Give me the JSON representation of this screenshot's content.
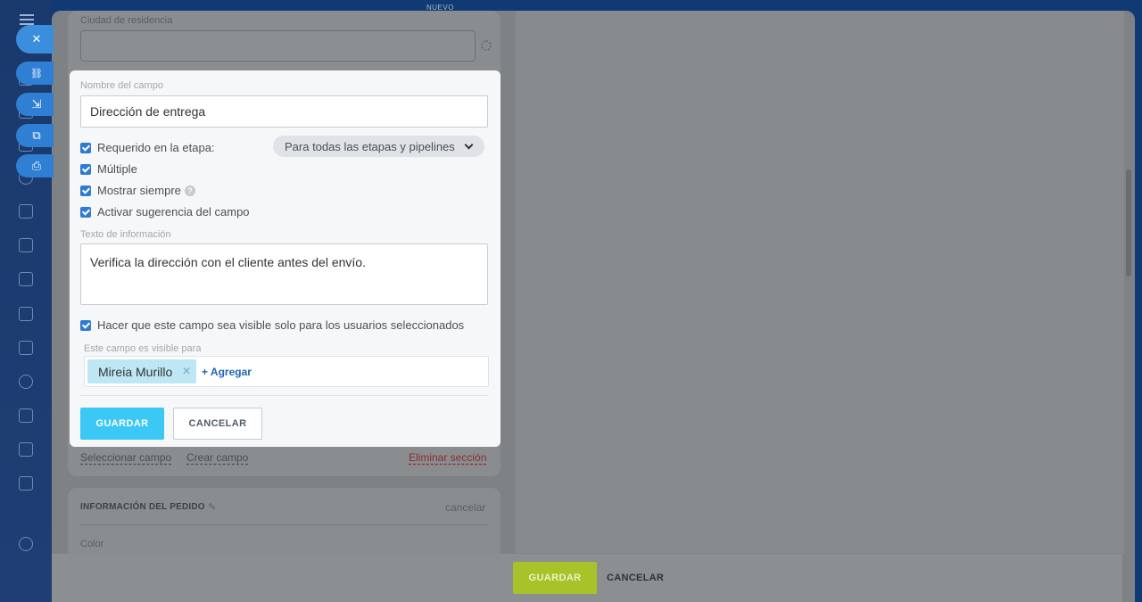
{
  "app": {
    "top_label": "NUEVO"
  },
  "rail_icons": [
    "menu-icon",
    "chat-icon",
    "feed-icon",
    "target-icon",
    "calendar-icon",
    "document-icon",
    "board-icon",
    "card-icon",
    "mail-icon",
    "contacts-icon",
    "tasks-icon",
    "filter-icon",
    "robot-icon",
    "more-icon",
    "settings-icon"
  ],
  "side_actions": [
    {
      "icon": "close-icon",
      "glyph": "✕"
    },
    {
      "icon": "link-icon",
      "glyph": "🔗"
    },
    {
      "icon": "download-icon",
      "glyph": "⇲"
    },
    {
      "icon": "open-external-icon",
      "glyph": "⧉"
    },
    {
      "icon": "print-icon",
      "glyph": "⎙"
    }
  ],
  "background_form": {
    "residence_label": "Ciudad de residencia",
    "select_field_link": "Seleccionar campo",
    "create_field_link": "Crear campo",
    "delete_section_link": "Eliminar sección",
    "order_section_title": "INFORMACIÓN DEL PEDIDO",
    "order_section_cancel": "cancelar",
    "color_label": "Color"
  },
  "field_editor": {
    "name_label": "Nombre del campo",
    "name_value": "Dirección de entrega",
    "required_label": "Requerido en la etapa:",
    "stage_select_value": "Para todas las etapas y pipelines",
    "multiple_label": "Múltiple",
    "always_show_label": "Mostrar siempre",
    "suggestions_label": "Activar sugerencia del campo",
    "info_text_label": "Texto de información",
    "info_text_value": "Verifica la dirección con el cliente antes del envío.",
    "visible_selected_label": "Hacer que este campo sea visible solo para los usuarios seleccionados",
    "visible_for_label": "Este campo es visible para",
    "users": [
      "Mireia Murillo"
    ],
    "add_label": "+ Agregar",
    "save_label": "GUARDAR",
    "cancel_label": "CANCELAR"
  },
  "bottom_bar": {
    "save_label": "GUARDAR",
    "cancel_label": "CANCELAR"
  },
  "colors": {
    "save_blue": "#3bc8f5",
    "save_green": "#a8c22a",
    "checkbox": "#2f7ad3",
    "delete_red": "#8c2d2d"
  }
}
